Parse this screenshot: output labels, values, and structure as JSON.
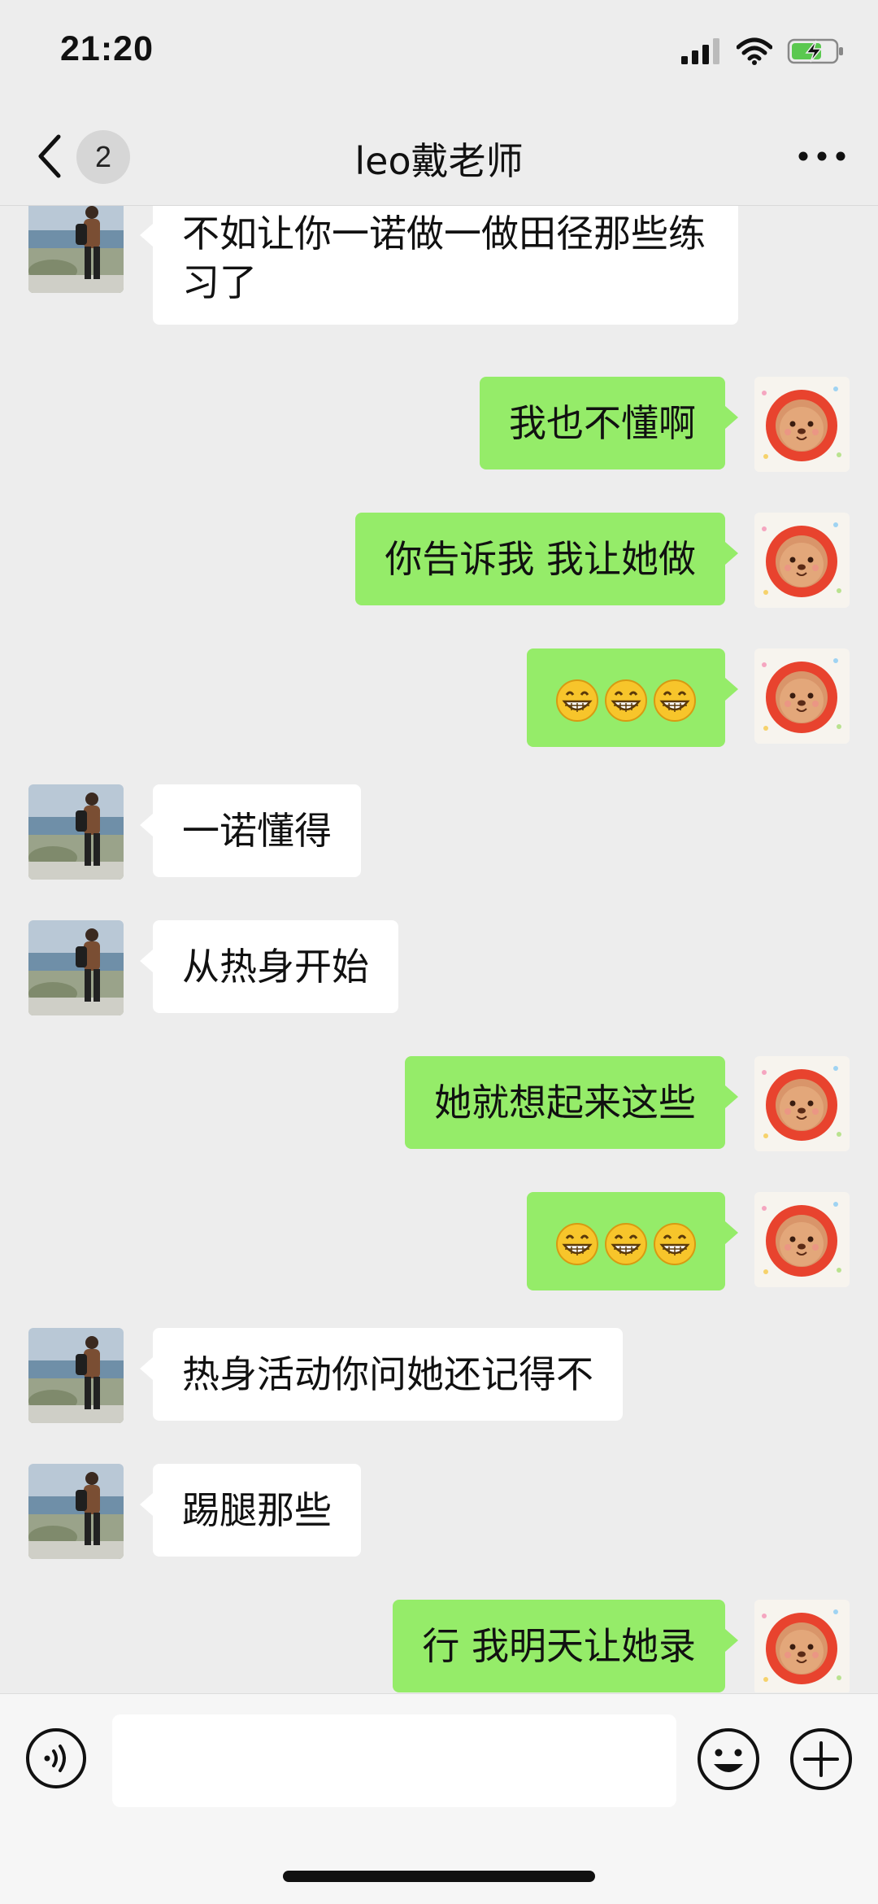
{
  "status_bar": {
    "time": "21:20"
  },
  "header": {
    "unread_count": "2",
    "title": "leo戴老师"
  },
  "messages": [
    {
      "side": "in",
      "text": "不如让你一诺做一做田径那些练习了"
    },
    {
      "side": "out",
      "text": "我也不懂啊"
    },
    {
      "side": "out",
      "text": "你告诉我 我让她做"
    },
    {
      "side": "out",
      "emoji": [
        "grin-emoji",
        "grin-emoji",
        "grin-emoji"
      ]
    },
    {
      "side": "in",
      "text": "一诺懂得"
    },
    {
      "side": "in",
      "text": "从热身开始"
    },
    {
      "side": "out",
      "text": "她就想起来这些"
    },
    {
      "side": "out",
      "emoji": [
        "grin-emoji",
        "grin-emoji",
        "grin-emoji"
      ]
    },
    {
      "side": "in",
      "text": "热身活动你问她还记得不"
    },
    {
      "side": "in",
      "text": "踢腿那些"
    },
    {
      "side": "out",
      "text": "行 我明天让她录"
    }
  ],
  "input_bar": {
    "value": ""
  },
  "colors": {
    "outgoing_bubble": "#95ec69",
    "incoming_bubble": "#ffffff",
    "background": "#ededed"
  }
}
